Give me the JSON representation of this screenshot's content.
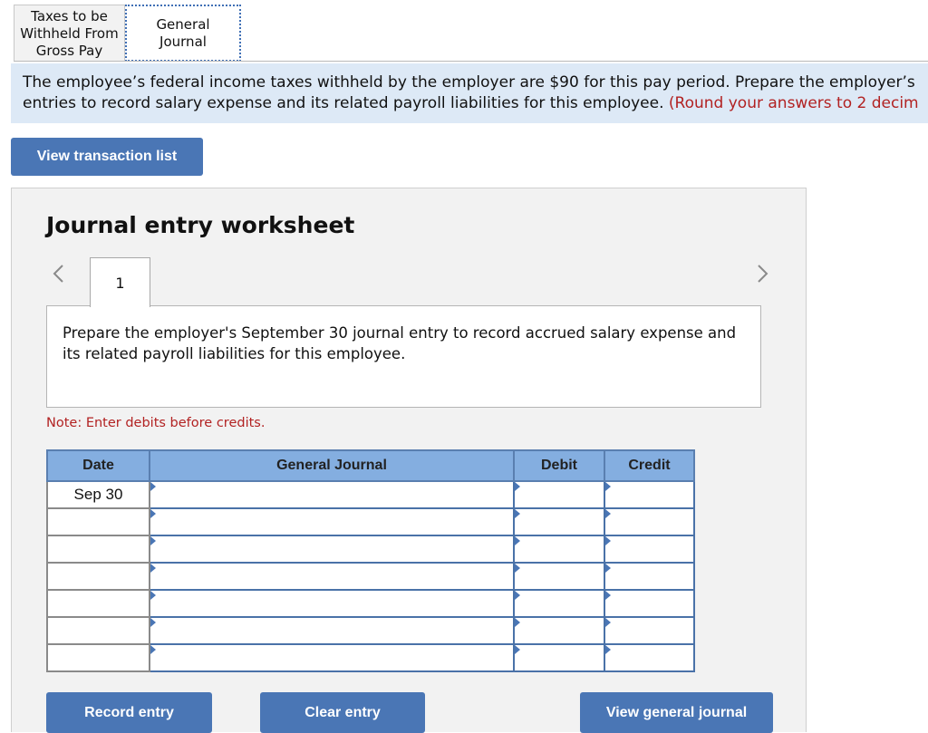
{
  "tabs": [
    {
      "label": "Taxes to be Withheld From Gross Pay",
      "lines": [
        "Taxes to be",
        "Withheld From",
        "Gross Pay"
      ],
      "active": false
    },
    {
      "label": "General Journal",
      "lines": [
        "General",
        "Journal"
      ],
      "active": true
    }
  ],
  "instructions": {
    "line1": "The employee’s federal income taxes withheld by the employer are $90 for this pay period. Prepare the employer’s",
    "line2": "entries to record salary expense and its related payroll liabilities for this employee.",
    "hint": "(Round your answers to 2 decim"
  },
  "buttons": {
    "view_transaction_list": "View transaction list",
    "record_entry": "Record entry",
    "clear_entry": "Clear entry",
    "view_general_journal": "View general journal"
  },
  "worksheet": {
    "title": "Journal entry worksheet",
    "current_step": "1",
    "prev_icon": "chevron-left-icon",
    "next_icon": "chevron-right-icon",
    "task": "Prepare the employer's September 30 journal entry to record accrued salary expense and its related payroll liabilities for this employee.",
    "note": "Note: Enter debits before credits."
  },
  "table": {
    "headers": {
      "date": "Date",
      "general_journal": "General Journal",
      "debit": "Debit",
      "credit": "Credit"
    },
    "rows": [
      {
        "date": "Sep 30",
        "account": "",
        "debit": "",
        "credit": ""
      },
      {
        "date": "",
        "account": "",
        "debit": "",
        "credit": ""
      },
      {
        "date": "",
        "account": "",
        "debit": "",
        "credit": ""
      },
      {
        "date": "",
        "account": "",
        "debit": "",
        "credit": ""
      },
      {
        "date": "",
        "account": "",
        "debit": "",
        "credit": ""
      },
      {
        "date": "",
        "account": "",
        "debit": "",
        "credit": ""
      },
      {
        "date": "",
        "account": "",
        "debit": "",
        "credit": ""
      }
    ]
  },
  "colors": {
    "button": "#4a76b5",
    "header": "#84aee0",
    "instructions_bg": "#dde9f6",
    "hint_red": "#b22222"
  }
}
